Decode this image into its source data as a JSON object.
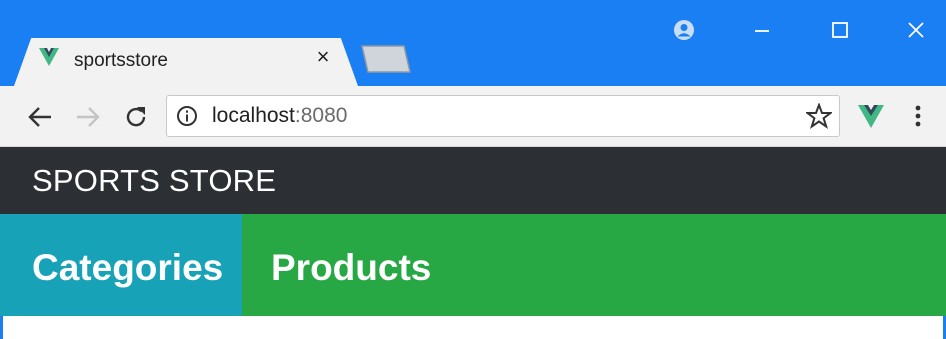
{
  "browser": {
    "tab": {
      "title": "sportsstore",
      "favicon": "vue-logo-icon",
      "close": "×"
    },
    "new_tab": "new-tab-icon",
    "window_controls": [
      "profile-icon",
      "minimize-icon",
      "maximize-icon",
      "close-icon"
    ],
    "nav": [
      "back-arrow-icon",
      "forward-arrow-icon",
      "reload-icon"
    ],
    "address": {
      "host": "localhost",
      "port": ":8080",
      "info_icon": "info-icon"
    },
    "toolbar_icons": [
      "star-icon",
      "vue-devtools-icon",
      "more-menu-icon"
    ],
    "colors": {
      "titlebar": "#1a7ff2",
      "toolbar": "#f2f2f2"
    }
  },
  "page": {
    "navbar": {
      "brand": "SPORTS STORE",
      "color": "#2c3035"
    },
    "categories_header": {
      "label": "Categories",
      "color": "#17a2b8"
    },
    "products_header": {
      "label": "Products",
      "color": "#28a745"
    }
  }
}
